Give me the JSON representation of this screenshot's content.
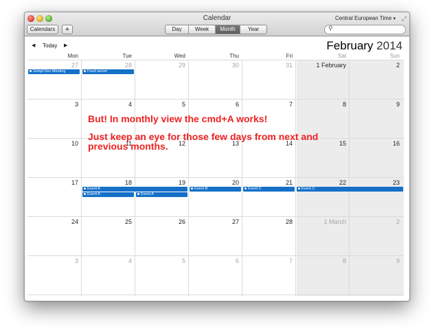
{
  "window": {
    "title": "Calendar",
    "timezone": "Central European Time",
    "caret": "▾",
    "resize_icon": "⤢"
  },
  "toolbar": {
    "calendars_label": "Calendars",
    "add_label": "+",
    "views": [
      "Day",
      "Week",
      "Month",
      "Year"
    ],
    "selected_view": "Month",
    "search_icon": "⚲",
    "search_placeholder": ""
  },
  "nav": {
    "prev": "◀",
    "today": "Today",
    "next": "▶",
    "month": "February",
    "year": "2014"
  },
  "weekdays": [
    "Mon",
    "Tue",
    "Wed",
    "Thu",
    "Fri",
    "Sat",
    "Sun"
  ],
  "weeks": [
    [
      "27",
      "28",
      "29",
      "30",
      "31",
      "1 February",
      "2"
    ],
    [
      "3",
      "4",
      "5",
      "6",
      "7",
      "8",
      "9"
    ],
    [
      "10",
      "11",
      "12",
      "13",
      "14",
      "15",
      "16"
    ],
    [
      "17",
      "18",
      "19",
      "20",
      "21",
      "22",
      "23"
    ],
    [
      "24",
      "25",
      "26",
      "27",
      "28",
      "1 March",
      "2"
    ],
    [
      "3",
      "4",
      "5",
      "6",
      "7",
      "8",
      "9"
    ]
  ],
  "events": {
    "e1": "Getqd Dev Meeting",
    "e2": "Food server",
    "e3": "Event A",
    "e4": "Event B",
    "e5": "Event C",
    "e6": "Event C",
    "e7": "Event A",
    "e8": "Event A"
  },
  "annotation": {
    "line1": "But! In monthly view the cmd+A works!",
    "line2": "Just keep an eye for those few days from next and previous months."
  },
  "colors": {
    "event": "#1570c9",
    "annotation": "#ee2222"
  }
}
